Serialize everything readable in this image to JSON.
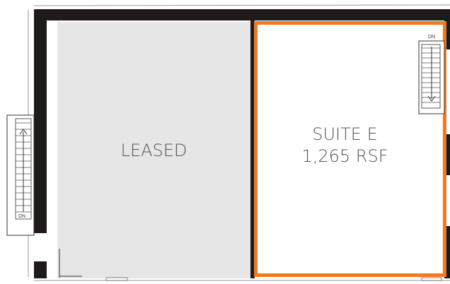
{
  "units": [
    {
      "id": "leased",
      "label": "LEASED",
      "fill": "#e6e6e6",
      "highlight": false
    },
    {
      "id": "suite-e",
      "label": "SUITE E",
      "area": "1,265 RSF",
      "fill": "#ffffff",
      "highlight": true
    }
  ],
  "stairs": {
    "left_label": "DN",
    "right_label": "DN"
  },
  "colors": {
    "wall": "#1f1a1a",
    "highlight": "#ee7a22",
    "leased_fill": "#e6e6e6",
    "text": "#555555"
  }
}
